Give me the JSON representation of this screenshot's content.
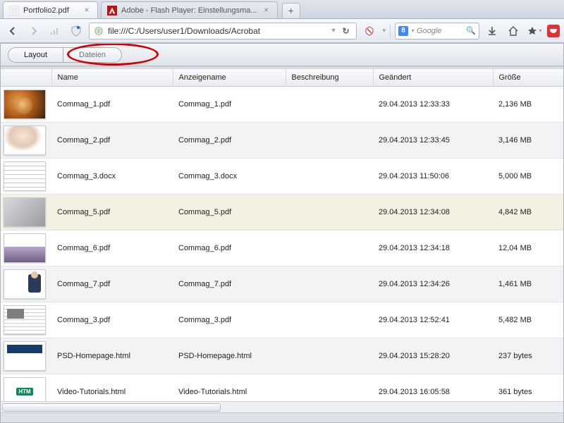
{
  "tabs": [
    {
      "title": "Portfolio2.pdf"
    },
    {
      "title": "Adobe - Flash Player: Einstellungsma..."
    }
  ],
  "url": "file:///C:/Users/user1/Downloads/Acrobat",
  "search_placeholder": "Google",
  "modes": {
    "layout": "Layout",
    "files": "Dateien"
  },
  "columns": {
    "name": "Name",
    "display": "Anzeigename",
    "desc": "Beschreibung",
    "modified": "Geändert",
    "size": "Größe"
  },
  "rows": [
    {
      "thumb": "t-lion",
      "name": "Commag_1.pdf",
      "display": "Commag_1.pdf",
      "desc": "",
      "modified": "29.04.2013 12:33:33",
      "size": "2,136 MB",
      "alt": false
    },
    {
      "thumb": "t-photo",
      "name": "Commag_2.pdf",
      "display": "Commag_2.pdf",
      "desc": "",
      "modified": "29.04.2013 12:33:45",
      "size": "3,146 MB",
      "alt": true
    },
    {
      "thumb": "t-doc",
      "name": "Commag_3.docx",
      "display": "Commag_3.docx",
      "desc": "",
      "modified": "29.04.2013 11:50:06",
      "size": "5,000 MB",
      "alt": false
    },
    {
      "thumb": "t-gray",
      "name": "Commag_5.pdf",
      "display": "Commag_5.pdf",
      "desc": "",
      "modified": "29.04.2013 12:34:08",
      "size": "4,842 MB",
      "sel": true
    },
    {
      "thumb": "t-pho2",
      "name": "Commag_6.pdf",
      "display": "Commag_6.pdf",
      "desc": "",
      "modified": "29.04.2013 12:34:18",
      "size": "12,04 MB",
      "alt": false
    },
    {
      "thumb": "t-man",
      "name": "Commag_7.pdf",
      "display": "Commag_7.pdf",
      "desc": "",
      "modified": "29.04.2013 12:34:26",
      "size": "1,461 MB",
      "alt": true
    },
    {
      "thumb": "t-news",
      "name": "Commag_3.pdf",
      "display": "Commag_3.pdf",
      "desc": "",
      "modified": "29.04.2013 12:52:41",
      "size": "5,482 MB",
      "alt": false
    },
    {
      "thumb": "t-html",
      "name": "PSD-Homepage.html",
      "display": "PSD-Homepage.html",
      "desc": "",
      "modified": "29.04.2013 15:28:20",
      "size": "237 bytes",
      "alt": true
    },
    {
      "thumb": "t-htm",
      "name": "Video-Tutorials.html",
      "display": "Video-Tutorials.html",
      "desc": "",
      "modified": "29.04.2013 16:05:58",
      "size": "361 bytes",
      "alt": false
    }
  ]
}
